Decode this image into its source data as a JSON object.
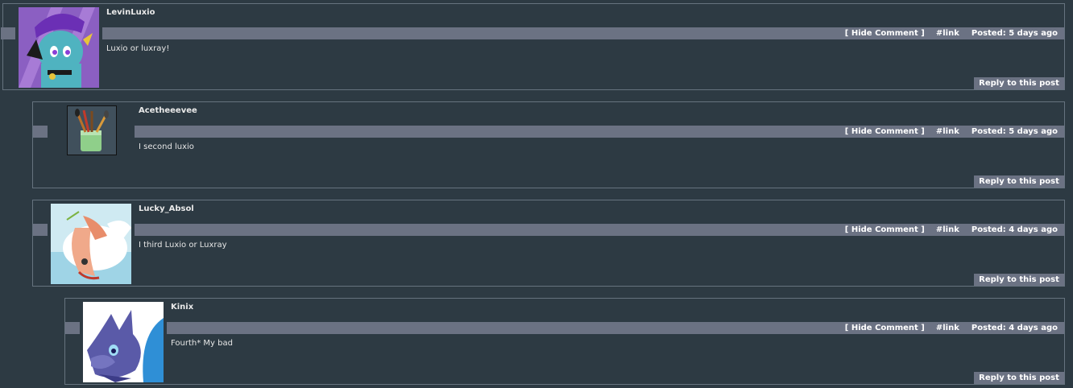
{
  "ui": {
    "hide_comment": "[ Hide Comment ]",
    "link": "#link",
    "reply": "Reply to this post"
  },
  "comments": [
    {
      "username": "LevinLuxio",
      "posted": "Posted: 5 days ago",
      "text": "Luxio or luxray!",
      "avatar_icon": "luxio-avatar-icon"
    },
    {
      "username": "Acetheeevee",
      "posted": "Posted: 5 days ago",
      "text": "I second luxio",
      "avatar_icon": "paintbrush-cup-avatar-icon"
    },
    {
      "username": "Lucky_Absol",
      "posted": "Posted: 4 days ago",
      "text": "I third Luxio or Luxray",
      "avatar_icon": "absol-avatar-icon"
    },
    {
      "username": "Kinix",
      "posted": "Posted: 4 days ago",
      "text": "Fourth* My bad",
      "avatar_icon": "blue-wolf-avatar-icon"
    }
  ],
  "colors": {
    "background": "#2d3a43",
    "border": "#66737f",
    "bar": "#6b7283"
  }
}
